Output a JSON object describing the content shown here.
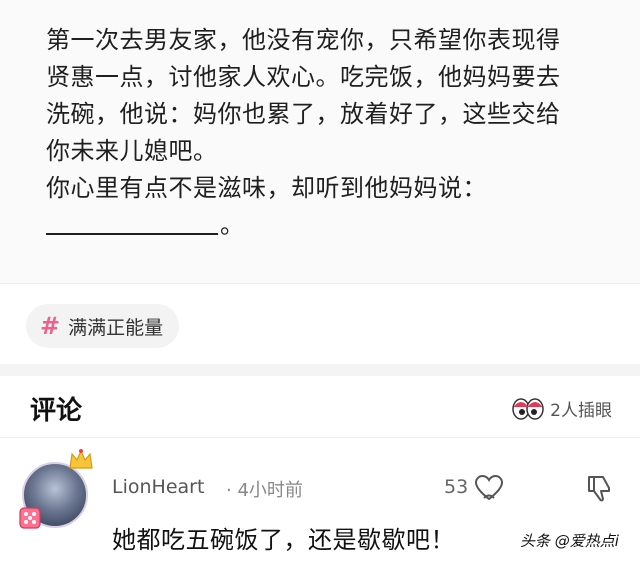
{
  "post": {
    "lines": [
      "第一次去男友家，他没有宠你，只希望你表现得",
      "贤惠一点，讨他家人欢心。吃完饭，他妈妈要去",
      "洗碗，他说：妈你也累了，放着好了，这些交给",
      "你未来儿媳吧。",
      "你心里有点不是滋味，却听到他妈妈说："
    ],
    "blank_end": "。"
  },
  "topic_tag": {
    "icon": "hash-icon",
    "label": "满满正能量"
  },
  "comments_section": {
    "title": "评论",
    "insert_eye_icon": "eyes-icon",
    "insert_eye_label": "2人插眼"
  },
  "comment": {
    "username": "LionHeart",
    "time": "· 4小时前",
    "likes": "53",
    "text": "她都吃五碗饭了，还是歇歇吧！",
    "watermark": "头条 @爱热点i"
  },
  "colors": {
    "accent": "#f0608c",
    "text": "#1f1f1f",
    "muted": "#888888"
  }
}
